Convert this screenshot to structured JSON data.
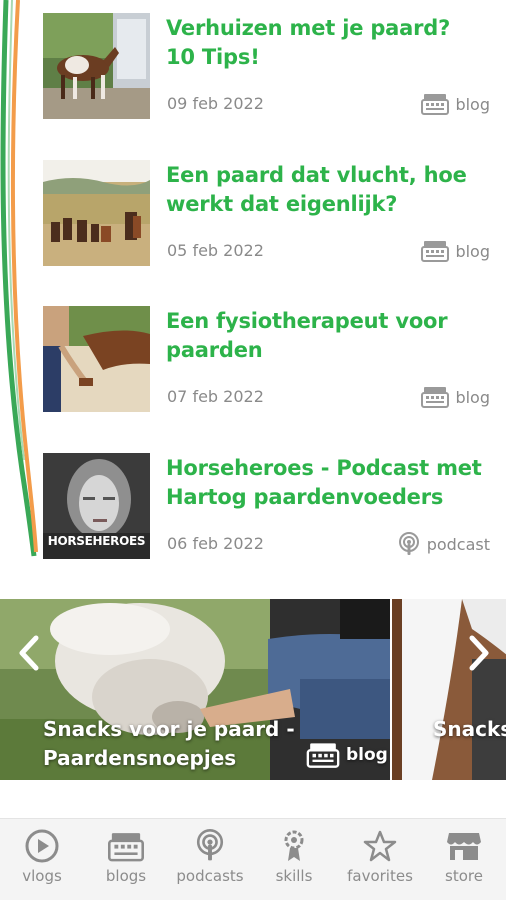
{
  "feed": {
    "items": [
      {
        "title": "Verhuizen met je paard? 10 Tips!",
        "date": "09 feb 2022",
        "type": "blog",
        "type_icon": "newspaper-icon"
      },
      {
        "title": "Een paard dat vlucht, hoe werkt dat eigenlijk?",
        "date": "05 feb 2022",
        "type": "blog",
        "type_icon": "newspaper-icon"
      },
      {
        "title": "Een fysiotherapeut voor paarden",
        "date": "07 feb 2022",
        "type": "blog",
        "type_icon": "newspaper-icon"
      },
      {
        "title": "Horseheroes - Podcast met Hartog paardenvoeders",
        "date": "06 feb 2022",
        "type": "podcast",
        "type_icon": "podcast-icon"
      }
    ],
    "podcast_cover_text": "HORSEHEROES"
  },
  "carousel": {
    "slides": [
      {
        "title": "Snacks voor je paard - Paardensnoepjes",
        "type": "blog"
      },
      {
        "title": "Snacks Mensel"
      }
    ]
  },
  "nav": {
    "items": [
      {
        "label": "vlogs",
        "icon": "play-circle-icon"
      },
      {
        "label": "blogs",
        "icon": "newspaper-icon"
      },
      {
        "label": "podcasts",
        "icon": "podcast-icon"
      },
      {
        "label": "skills",
        "icon": "skills-icon"
      },
      {
        "label": "favorites",
        "icon": "star-icon"
      },
      {
        "label": "store",
        "icon": "store-icon"
      }
    ]
  },
  "colors": {
    "title_green": "#2db34a",
    "meta_gray": "#8a8a8a",
    "nav_bg": "#f4f4f4",
    "nav_icon": "#8c8c8c",
    "deco_green": "#3aa857",
    "deco_orange": "#f39c4a"
  }
}
